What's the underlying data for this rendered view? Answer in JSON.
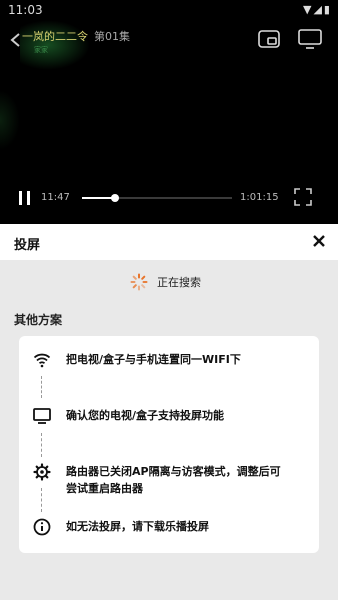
{
  "status_bar": {
    "time": "11:03",
    "icons": "▼◢▮"
  },
  "player": {
    "title": "一岚的二二令",
    "episode": "第01集",
    "subtitle": "家家",
    "current_time": "11:47",
    "duration": "1:01:15",
    "progress": 0.22
  },
  "cast_panel": {
    "title": "投屏",
    "searching_text": "正在搜索",
    "other_title": "其他方案",
    "steps": [
      {
        "icon": "wifi-icon",
        "lines": [
          "把电视/盒子与手机连置同一WIFI下"
        ]
      },
      {
        "icon": "monitor-icon",
        "lines": [
          "确认您的电视/盒子支持投屏功能"
        ]
      },
      {
        "icon": "gear-icon",
        "lines": [
          "路由器已关闭AP隔离与访客模式，调整后可",
          "尝试重启路由器"
        ]
      },
      {
        "icon": "info-icon",
        "lines": [
          "如无法投屏，请下载乐播投屏"
        ]
      }
    ]
  },
  "colors": {
    "accent_orange": "#e8742a",
    "title_yellow": "#d6d070"
  }
}
